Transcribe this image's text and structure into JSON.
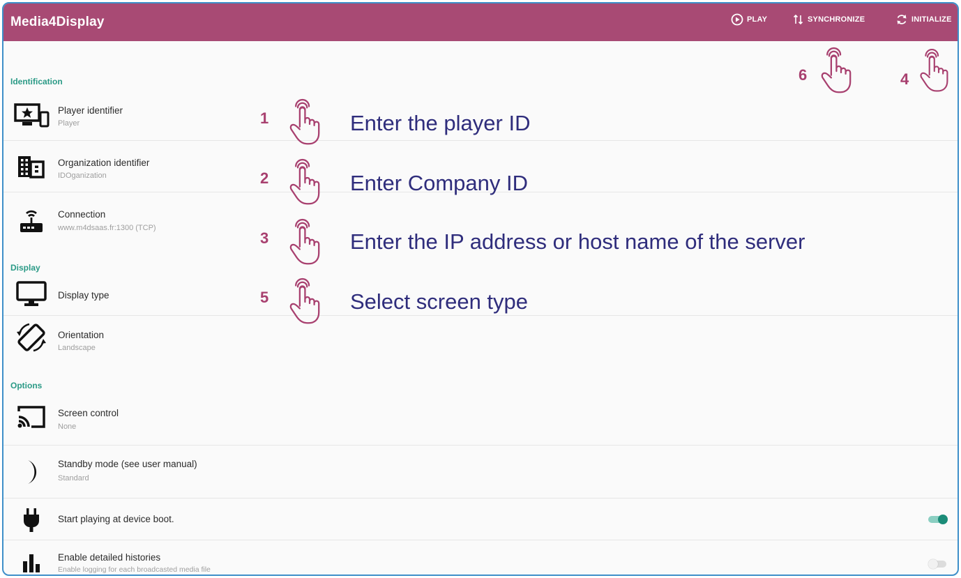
{
  "app": {
    "title": "Media4Display"
  },
  "toolbar": {
    "play_label": "PLAY",
    "sync_label": "SYNCHRONIZE",
    "init_label": "INITIALIZE"
  },
  "sections": {
    "identification": "Identification",
    "display": "Display",
    "options": "Options"
  },
  "settings": {
    "player": {
      "title": "Player identifier",
      "value": "Player"
    },
    "organization": {
      "title": "Organization identifier",
      "value": "IDOganization"
    },
    "connection": {
      "title": "Connection",
      "value": "www.m4dsaas.fr:1300 (TCP)"
    },
    "display_type": {
      "title": "Display type"
    },
    "orientation": {
      "title": "Orientation",
      "value": "Landscape"
    },
    "screen_control": {
      "title": "Screen control",
      "value": "None"
    },
    "standby": {
      "title": "Standby mode (see user manual)",
      "value": "Standard"
    },
    "autostart": {
      "title": "Start playing at device boot.",
      "enabled": true
    },
    "histories": {
      "title": "Enable detailed histories",
      "value": "Enable logging for each broadcasted media file",
      "enabled": false
    }
  },
  "annotations": [
    {
      "num": "1",
      "text": "Enter the player ID"
    },
    {
      "num": "2",
      "text": "Enter Company ID"
    },
    {
      "num": "3",
      "text": "Enter the IP address or host name of the server"
    },
    {
      "num": "5",
      "text": "Select screen type"
    },
    {
      "num": "6"
    },
    {
      "num": "4"
    }
  ],
  "colors": {
    "appbar": "#a84a74",
    "accent": "#2a9a86",
    "annotation_number": "#a8406f",
    "annotation_text": "#2f2d7c"
  },
  "icons": {
    "play": "play-circle-icon",
    "sync": "sync-arrows-icon",
    "init": "refresh-icon",
    "hand": "tap-hand-icon"
  }
}
